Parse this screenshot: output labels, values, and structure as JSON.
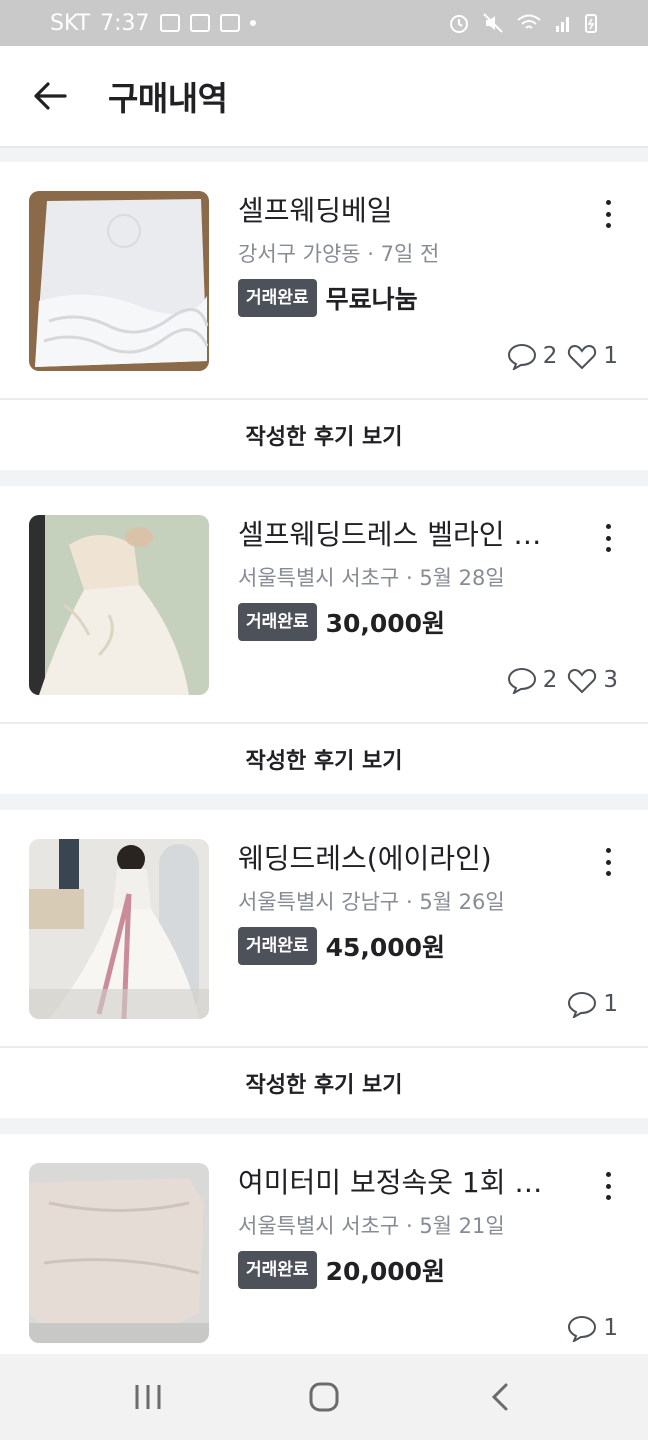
{
  "status_bar": {
    "carrier": "SKT",
    "time": "7:37"
  },
  "header": {
    "title": "구매내역"
  },
  "items": [
    {
      "title": "셀프웨딩베일",
      "location": "강서구 가양동",
      "time": "7일 전",
      "badge": "거래완료",
      "price": "무료나눔",
      "comments": "2",
      "likes": "1",
      "review_label": "작성한 후기 보기"
    },
    {
      "title": "셀프웨딩드레스 벨라인 …",
      "location": "서울특별시 서초구",
      "time": "5월 28일",
      "badge": "거래완료",
      "price": "30,000원",
      "comments": "2",
      "likes": "3",
      "review_label": "작성한 후기 보기"
    },
    {
      "title": "웨딩드레스(에이라인)",
      "location": "서울특별시 강남구",
      "time": "5월 26일",
      "badge": "거래완료",
      "price": "45,000원",
      "comments": "1",
      "review_label": "작성한 후기 보기"
    },
    {
      "title": "여미터미 보정속옷 1회 …",
      "location": "서울특별시 서초구",
      "time": "5월 21일",
      "badge": "거래완료",
      "price": "20,000원",
      "comments": "1"
    }
  ],
  "separator": "·",
  "colors": {
    "badge_bg": "#4d5159",
    "text": "#212124",
    "meta": "#868b94"
  }
}
